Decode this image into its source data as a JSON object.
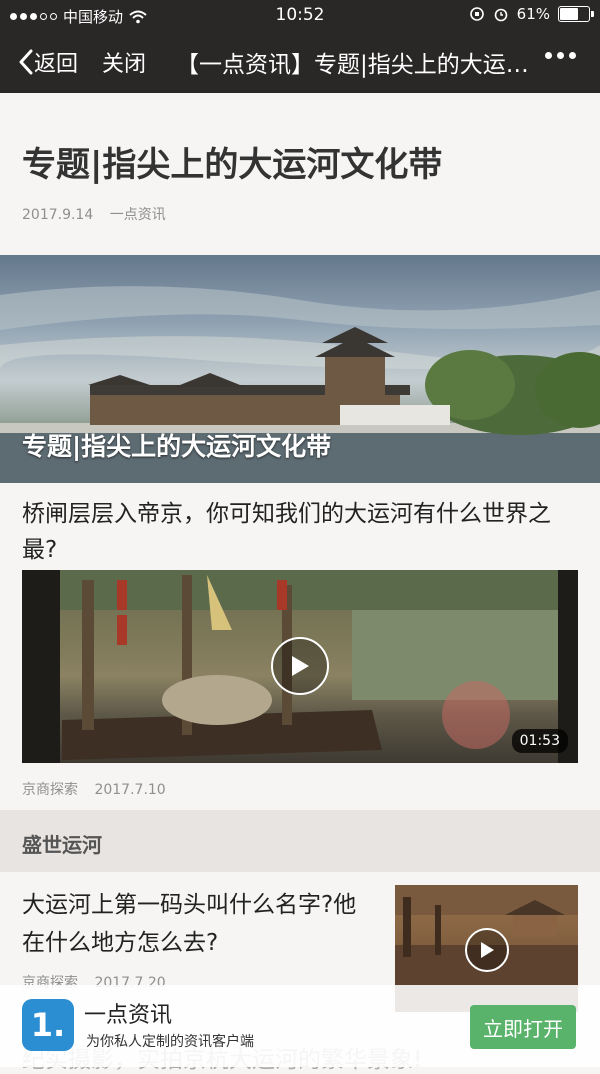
{
  "status_bar": {
    "carrier": "中国移动",
    "time": "10:52",
    "battery_percent": "61%",
    "battery_level": 0.61
  },
  "nav": {
    "back_label": "返回",
    "close_label": "关闭",
    "title": "【一点资讯】专题|指尖上的大运河文化带"
  },
  "article": {
    "title": "专题|指尖上的大运河文化带",
    "date": "2017.9.14",
    "source": "一点资讯"
  },
  "banner": {
    "caption": "专题|指尖上的大运河文化带"
  },
  "feature": {
    "question": "桥闸层层入帝京，你可知我们的大运河有什么世界之最?",
    "video_duration": "01:53",
    "source": "京商探索",
    "date": "2017.7.10"
  },
  "section": {
    "label": "盛世运河"
  },
  "list_item": {
    "title": "大运河上第一码头叫什么名字?他在什么地方怎么去?",
    "source": "京商探索",
    "date": "2017.7.20"
  },
  "next_item_peek": "纪实摄影，实拍京杭大运河的繁华景象!",
  "app_banner": {
    "logo_text": "1.",
    "name": "一点资讯",
    "slogan": "为你私人定制的资讯客户端",
    "open_button": "立即打开",
    "button_color": "#5ab36a",
    "logo_color": "#2b8ed2"
  },
  "icons": {
    "back": "chevron-left-icon",
    "more": "more-dots-icon",
    "wifi": "wifi-icon",
    "play": "play-icon"
  }
}
